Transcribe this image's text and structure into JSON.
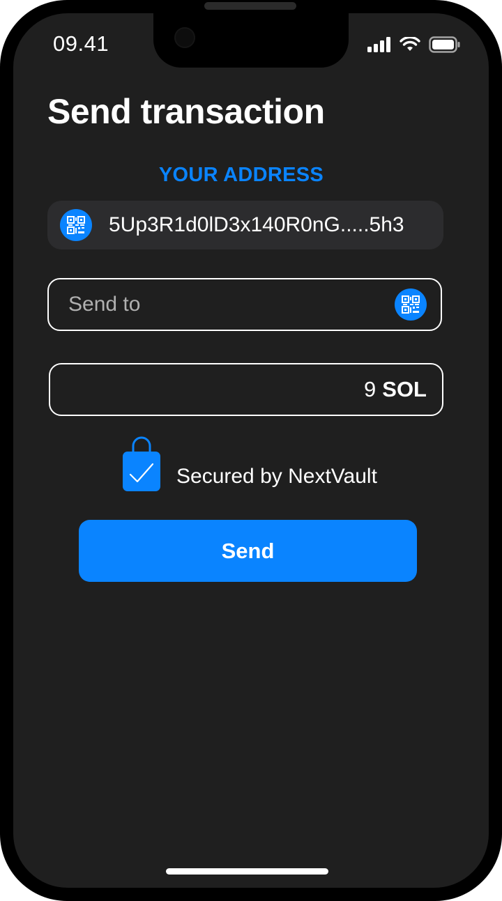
{
  "status_bar": {
    "time": "09.41",
    "icons": [
      "signal-icon",
      "wifi-icon",
      "battery-icon"
    ]
  },
  "page": {
    "title": "Send transaction"
  },
  "your_address": {
    "label": "YOUR ADDRESS",
    "value": "5Up3R1d0lD3x140R0nG.....5h3",
    "icon": "qr-code-icon"
  },
  "send_to": {
    "placeholder": "Send to",
    "value": "",
    "icon": "qr-code-icon"
  },
  "amount": {
    "value": "9",
    "unit": "SOL"
  },
  "security": {
    "label": "Secured by NextVault",
    "icon": "shopping-bag-check-icon"
  },
  "send_button": {
    "label": "Send"
  },
  "colors": {
    "accent": "#0a84ff",
    "background": "#1f1f1f",
    "pill": "#2c2c2e",
    "text": "#ffffff"
  }
}
